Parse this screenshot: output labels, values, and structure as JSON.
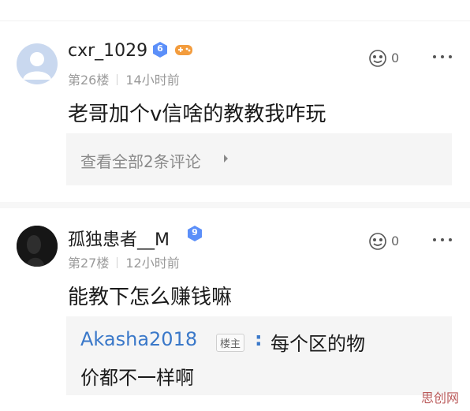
{
  "comments": [
    {
      "username": "cxr_1029",
      "badge_level": "6",
      "floor": "第26楼",
      "time": "14小时前",
      "likes": "0",
      "text": "老哥加个v信啥的教教我咋玩",
      "view_all": "查看全部2条评论"
    },
    {
      "username": "孤独患者__M",
      "badge_level": "9",
      "floor": "第27楼",
      "time": "12小时前",
      "likes": "0",
      "text": "能教下怎么赚钱嘛",
      "reply": {
        "author": "Akasha2018",
        "tag": "楼主",
        "colon": ":",
        "line1": "每个区的物",
        "line2": "价都不一样啊"
      }
    }
  ],
  "watermark": "思创网",
  "colors": {
    "badge": "#5b8ff9",
    "link": "#3a78c9",
    "meta": "#9a9a9a"
  }
}
